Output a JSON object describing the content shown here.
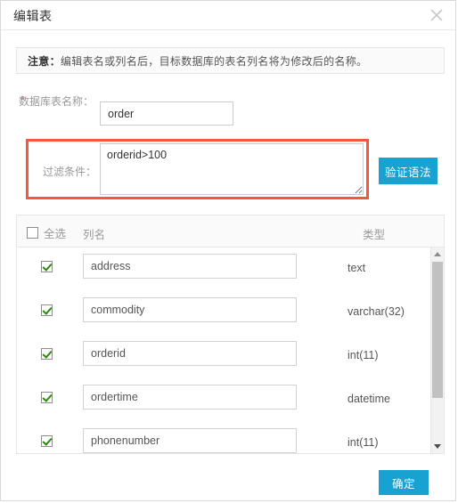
{
  "dialog": {
    "title": "编辑表",
    "close_icon": "close-icon"
  },
  "notice": {
    "prefix": "注意：",
    "text": "编辑表名或列名后，目标数据库的表名列名将为修改后的名称。"
  },
  "form": {
    "table_name": {
      "label": "数据库表名称：",
      "required_mark": "*",
      "value": "order",
      "placeholder": ""
    },
    "filter": {
      "label": "过滤条件：",
      "value": "orderid>100",
      "placeholder": "",
      "validate_button": "验证语法"
    }
  },
  "columns_panel": {
    "header": {
      "select_all_label": "全选",
      "select_all_checked": false,
      "column_name": "列名",
      "type": "类型"
    },
    "rows": [
      {
        "checked": true,
        "name": "address",
        "type": "text"
      },
      {
        "checked": true,
        "name": "commodity",
        "type": "varchar(32)"
      },
      {
        "checked": true,
        "name": "orderid",
        "type": "int(11)"
      },
      {
        "checked": true,
        "name": "ordertime",
        "type": "datetime"
      },
      {
        "checked": true,
        "name": "phonenumber",
        "type": "int(11)"
      }
    ],
    "scrollbar": {
      "up_icon": "triangle-up-icon",
      "down_icon": "triangle-down-icon"
    }
  },
  "footer": {
    "confirm_label": "确定"
  },
  "colors": {
    "accent": "#18a2d2",
    "highlight_border": "#f4573b",
    "required_star": "#e8503a",
    "checkbox_check": "#2a8a0a"
  }
}
